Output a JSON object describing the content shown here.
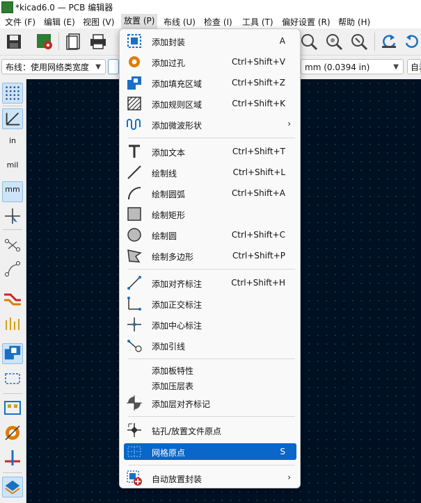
{
  "window": {
    "title": "*kicad6.0 — PCB 编辑器"
  },
  "menubar": [
    {
      "label": "文件 (F)"
    },
    {
      "label": "编辑 (E)"
    },
    {
      "label": "视图 (V)"
    },
    {
      "label": "放置 (P)"
    },
    {
      "label": "布线 (U)"
    },
    {
      "label": "检查 (I)"
    },
    {
      "label": "工具 (T)"
    },
    {
      "label": "偏好设置 (R)"
    },
    {
      "label": "帮助 (H)"
    }
  ],
  "toolbar2": {
    "track_combo": "布线：使用网络类宽度",
    "grid_combo": "mm (0.0394 in)",
    "auto_combo": "自动"
  },
  "place_menu": {
    "items": [
      {
        "label": "添加封装",
        "shortcut": "A"
      },
      {
        "label": "添加过孔",
        "shortcut": "Ctrl+Shift+V"
      },
      {
        "label": "添加填充区域",
        "shortcut": "Ctrl+Shift+Z"
      },
      {
        "label": "添加规则区域",
        "shortcut": "Ctrl+Shift+K"
      },
      {
        "label": "添加微波形状",
        "shortcut": "›"
      },
      {
        "label": "添加文本",
        "shortcut": "Ctrl+Shift+T"
      },
      {
        "label": "绘制线",
        "shortcut": "Ctrl+Shift+L"
      },
      {
        "label": "绘制圆弧",
        "shortcut": "Ctrl+Shift+A"
      },
      {
        "label": "绘制矩形",
        "shortcut": ""
      },
      {
        "label": "绘制圆",
        "shortcut": "Ctrl+Shift+C"
      },
      {
        "label": "绘制多边形",
        "shortcut": "Ctrl+Shift+P"
      },
      {
        "label": "添加对齐标注",
        "shortcut": "Ctrl+Shift+H"
      },
      {
        "label": "添加正交标注",
        "shortcut": ""
      },
      {
        "label": "添加中心标注",
        "shortcut": ""
      },
      {
        "label": "添加引线",
        "shortcut": ""
      },
      {
        "label": "添加板特性",
        "shortcut": ""
      },
      {
        "label": "添加压层表",
        "shortcut": ""
      },
      {
        "label": "添加层对齐标记",
        "shortcut": ""
      },
      {
        "label": "钻孔/放置文件原点",
        "shortcut": ""
      },
      {
        "label": "网格原点",
        "shortcut": "S"
      },
      {
        "label": "自动放置封装",
        "shortcut": "›"
      }
    ]
  },
  "left_tools": {
    "units": {
      "inch": "in",
      "mil": "mil",
      "mm": "mm"
    }
  },
  "colors": {
    "accent": "#0a66c9",
    "canvas": "#001023"
  }
}
